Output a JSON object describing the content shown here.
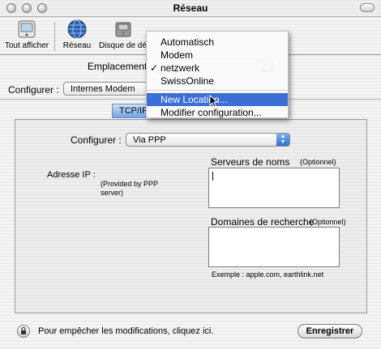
{
  "window": {
    "title": "Réseau"
  },
  "toolbar": {
    "show_all": "Tout afficher",
    "network": "Réseau",
    "startup_disk": "Disque de dém"
  },
  "location": {
    "label": "Emplacement",
    "selected": "netzwerk"
  },
  "configure_interface": {
    "label": "Configurer :",
    "value": "Internes Modem"
  },
  "tabs": [
    {
      "label": "TCP/IP",
      "selected": true
    }
  ],
  "menu": {
    "items": [
      {
        "label": "Automatisch",
        "checked": false
      },
      {
        "label": "Modem",
        "checked": false
      },
      {
        "label": "netzwerk",
        "checked": true
      },
      {
        "label": "SwissOnline",
        "checked": false
      }
    ],
    "actions": [
      {
        "label": "New Location...",
        "highlighted": true
      },
      {
        "label": "Modifier configuration...",
        "highlighted": false
      }
    ],
    "checkmark": "✓"
  },
  "tcpip": {
    "configure_label": "Configurer :",
    "configure_value": "Via PPP",
    "ip_label": "Adresse IP :",
    "ip_note": "(Provided by PPP server)",
    "dns_label": "Serveurs de noms",
    "dns_optional": "(Optionnel)",
    "dns_value": "",
    "search_label": "Domaines de recherche",
    "search_optional": "(Optionnel)",
    "search_value": "",
    "example": "Exemple : apple.com, earthlink.net"
  },
  "footer": {
    "lock_text": "Pour empêcher les modifications, cliquez ici.",
    "save_button": "Enregistrer"
  },
  "colors": {
    "accent": "#3a6fd8",
    "tab": "#6ea3e8"
  },
  "icons": {
    "show_all": "apple-prefs-icon",
    "network": "globe-icon",
    "startup_disk": "disk-icon",
    "lock": "lock-icon"
  }
}
